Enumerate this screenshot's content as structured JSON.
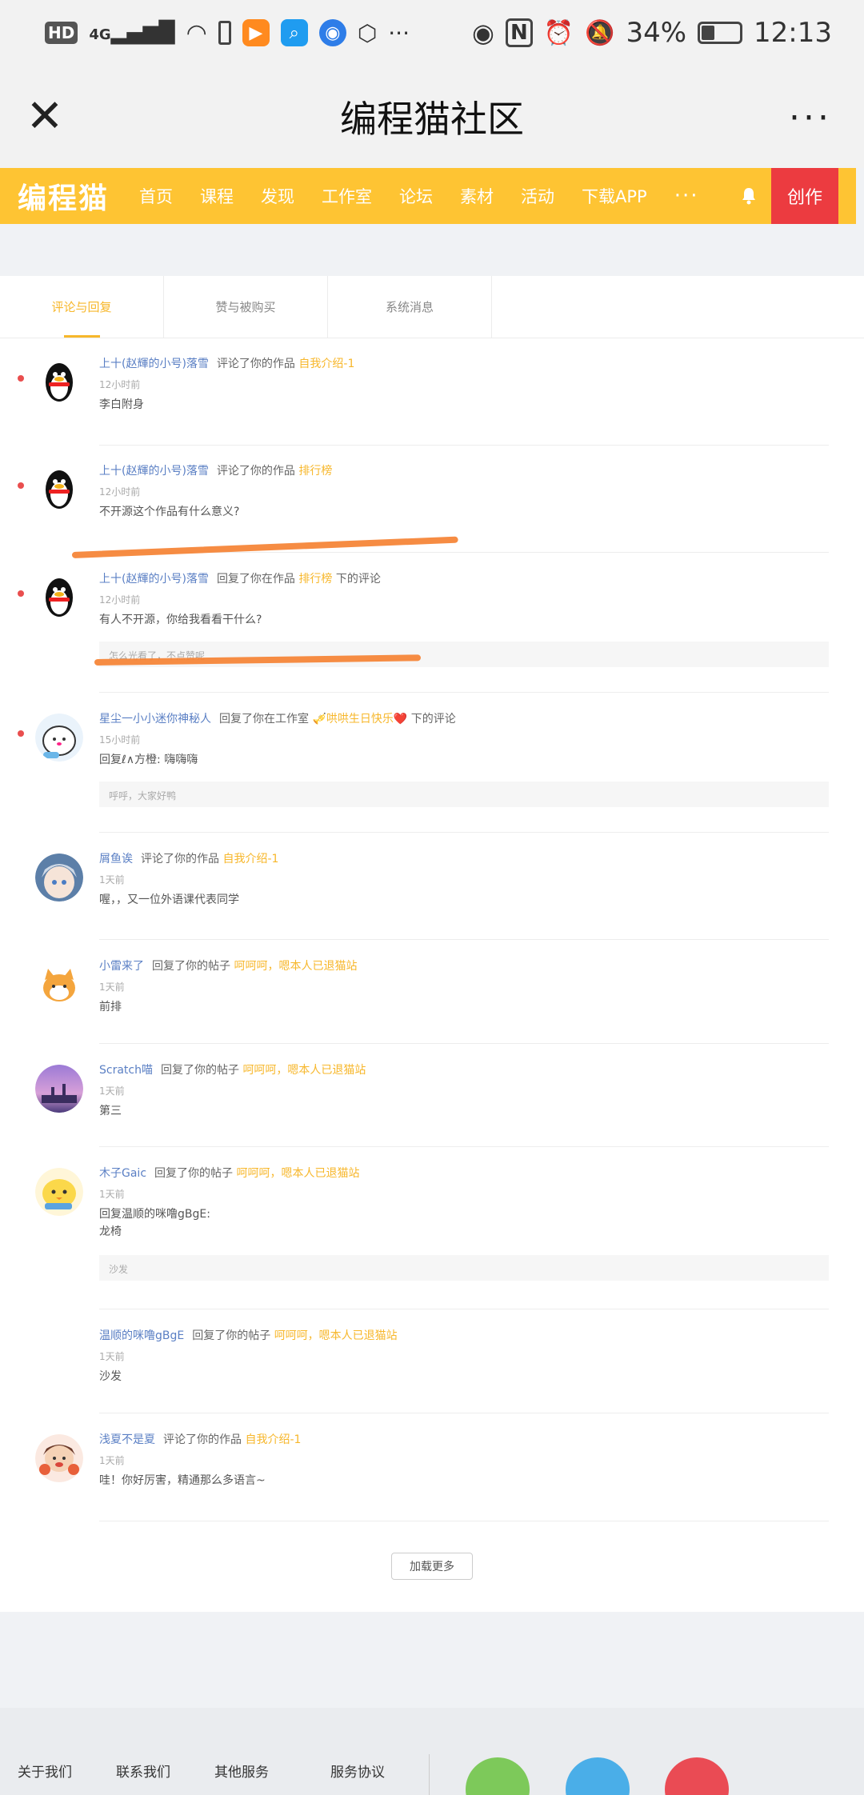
{
  "statusbar": {
    "hd": "HD",
    "signal": "4G",
    "battery": "34%",
    "time": "12:13",
    "icons": [
      "hd-icon",
      "signal-icon",
      "wifi-icon",
      "battery-saver-icon",
      "video-app-icon",
      "search-app-icon",
      "browser-app-icon",
      "hand-icon",
      "more-dots-icon",
      "eye-icon",
      "nfc-icon",
      "alarm-icon",
      "mute-icon",
      "battery-icon"
    ]
  },
  "titlebar": {
    "title": "编程猫社区",
    "more": "···",
    "close": "✕"
  },
  "nav": {
    "logo": "编程猫",
    "items": [
      "首页",
      "课程",
      "发现",
      "工作室",
      "论坛",
      "素材",
      "活动",
      "下载APP"
    ],
    "more": "···",
    "create": "创作"
  },
  "tabs": [
    "评论与回复",
    "赞与被购买",
    "系统消息"
  ],
  "messages": [
    {
      "user": "上十(赵輝的小号)落雪",
      "action": "评论了你的作品",
      "object": "自我介绍-1",
      "suffix": "",
      "time": "12小时前",
      "body": "李白附身",
      "quote": "",
      "unread": true
    },
    {
      "user": "上十(赵輝的小号)落雪",
      "action": "评论了你的作品",
      "object": "排行榜",
      "suffix": "",
      "time": "12小时前",
      "body": "不开源这个作品有什么意义?",
      "quote": "",
      "unread": true
    },
    {
      "user": "上十(赵輝的小号)落雪",
      "action": "回复了你在作品",
      "object": "排行榜",
      "suffix": "下的评论",
      "time": "12小时前",
      "body": "有人不开源，你给我看看干什么?",
      "quote": "怎么光看了，不点赞呢",
      "unread": true
    },
    {
      "user": "星尘一小小迷你神秘人",
      "action": "回复了你在工作室",
      "object": "🎺哄哄生日快乐❤️",
      "suffix": "下的评论",
      "time": "15小时前",
      "body": "回复ℓ∧方橙:  嗨嗨嗨",
      "quote": "呼呼，大家好鸭",
      "unread": true
    },
    {
      "user": "屑鱼诶",
      "action": "评论了你的作品",
      "object": "自我介绍-1",
      "suffix": "",
      "time": "1天前",
      "body": "喔，，又一位外语课代表同学",
      "quote": "",
      "unread": false
    },
    {
      "user": "小雷来了",
      "action": "回复了你的帖子",
      "object": "呵呵呵，嗯本人已退猫站",
      "suffix": "",
      "time": "1天前",
      "body": "前排",
      "quote": "",
      "unread": false
    },
    {
      "user": "Scratch喵",
      "action": "回复了你的帖子",
      "object": "呵呵呵，嗯本人已退猫站",
      "suffix": "",
      "time": "1天前",
      "body": "第三",
      "quote": "",
      "unread": false
    },
    {
      "user": "木子Gaic",
      "action": "回复了你的帖子",
      "object": "呵呵呵，嗯本人已退猫站",
      "suffix": "",
      "time": "1天前",
      "body": "回复温顺的咪噜gBgE:\n龙椅",
      "quote": "沙发",
      "unread": false
    },
    {
      "user": "温顺的咪噜gBgE",
      "action": "回复了你的帖子",
      "object": "呵呵呵，嗯本人已退猫站",
      "suffix": "",
      "time": "1天前",
      "body": "沙发",
      "quote": "",
      "unread": false
    },
    {
      "user": "浅夏不是夏",
      "action": "评论了你的作品",
      "object": "自我介绍-1",
      "suffix": "",
      "time": "1天前",
      "body": "哇！你好厉害，精通那么多语言~",
      "quote": "",
      "unread": false
    }
  ],
  "load_more": "加载更多",
  "footer": {
    "links": [
      "关于我们",
      "联系我们",
      "其他服务",
      "服务协议"
    ]
  },
  "colors": {
    "accent": "#fec433",
    "create": "#ec3b40",
    "link_user": "#5a7fc4",
    "link_object": "#f7b72b",
    "unread_dot": "#e94e4e",
    "scribble": "#f58233"
  }
}
